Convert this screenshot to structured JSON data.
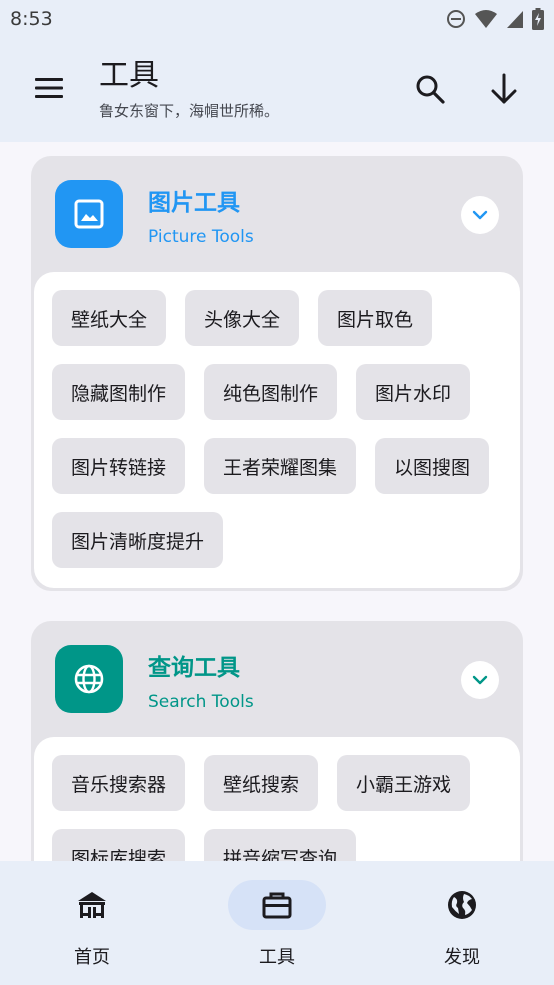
{
  "status_bar": {
    "time": "8:53"
  },
  "app_bar": {
    "title": "工具",
    "subtitle": "鲁女东窗下，海帽世所稀。"
  },
  "colors": {
    "picture_accent": "#2196f3",
    "search_accent": "#009688"
  },
  "picture_tools": {
    "title": "图片工具",
    "subtitle": "Picture Tools",
    "icon": "image-icon",
    "rows": [
      [
        "壁纸大全",
        "头像大全",
        "图片取色"
      ],
      [
        "隐藏图制作",
        "纯色图制作",
        "图片水印"
      ],
      [
        "图片转链接",
        "王者荣耀图集",
        "以图搜图"
      ],
      [
        "图片清晰度提升"
      ]
    ]
  },
  "search_tools": {
    "title": "查询工具",
    "subtitle": "Search Tools",
    "icon": "globe-icon",
    "rows": [
      [
        "音乐搜索器",
        "壁纸搜索",
        "小霸王游戏"
      ],
      [
        "图标库搜索",
        "拼音缩写查询"
      ]
    ]
  },
  "bottom_nav": {
    "items": [
      {
        "label": "首页",
        "icon": "home-icon"
      },
      {
        "label": "工具",
        "icon": "toolbox-icon"
      },
      {
        "label": "发现",
        "icon": "globe-icon"
      }
    ],
    "selected": "工具"
  }
}
